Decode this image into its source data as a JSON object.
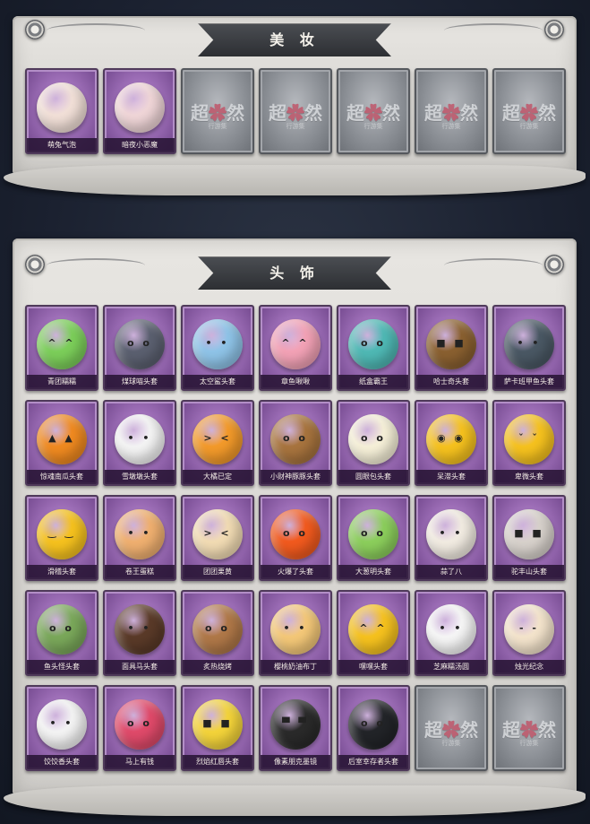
{
  "makeup": {
    "title": "美 妆",
    "items": [
      {
        "label": "萌兔气泡",
        "color": "#f2e0d8",
        "face": "",
        "filled": true
      },
      {
        "label": "暗夜小恶魔",
        "color": "#f0d6d8",
        "face": "",
        "filled": true
      },
      {
        "filled": false
      },
      {
        "filled": false
      },
      {
        "filled": false
      },
      {
        "filled": false
      },
      {
        "filled": false
      }
    ]
  },
  "headwear": {
    "title": "头 饰",
    "items": [
      {
        "label": "青团糯糯",
        "color": "#7ccf5a",
        "face": "^ ^",
        "filled": true
      },
      {
        "label": "煤球喵头套",
        "color": "#5b6070",
        "face": "o o",
        "filled": true
      },
      {
        "label": "太空鲨头套",
        "color": "#8fc4e8",
        "face": "• •",
        "filled": true
      },
      {
        "label": "章鱼啾啾",
        "color": "#f3a2b6",
        "face": "^ ^",
        "filled": true
      },
      {
        "label": "纸盒霸王",
        "color": "#4fb9b5",
        "face": "o o",
        "filled": true
      },
      {
        "label": "哈士奇头套",
        "color": "#8a6030",
        "face": "■ ■",
        "filled": true
      },
      {
        "label": "萨卡班甲鱼头套",
        "color": "#4a5864",
        "face": "• •",
        "filled": true
      },
      {
        "label": "惊魂南瓜头套",
        "color": "#f08a20",
        "face": "▲ ▲",
        "filled": true
      },
      {
        "label": "雪墩墩头套",
        "color": "#f4f4f4",
        "face": "• •",
        "filled": true
      },
      {
        "label": "大橘已定",
        "color": "#f39a2a",
        "face": "> <",
        "filled": true
      },
      {
        "label": "小财神豚豚头套",
        "color": "#a8743e",
        "face": "o o",
        "filled": true
      },
      {
        "label": "圆眼包头套",
        "color": "#f6f0d8",
        "face": "o o",
        "filled": true
      },
      {
        "label": "呆滞头套",
        "color": "#f6c21e",
        "face": "◉ ◉",
        "filled": true
      },
      {
        "label": "卑微头套",
        "color": "#f6c21e",
        "face": "ˇ ˇ",
        "filled": true
      },
      {
        "label": "滑稽头套",
        "color": "#f6c21e",
        "face": "‿ ‿",
        "filled": true
      },
      {
        "label": "卷王蛋糕",
        "color": "#f0b070",
        "face": "• •",
        "filled": true
      },
      {
        "label": "团团栗黄",
        "color": "#f2dcb4",
        "face": "> <",
        "filled": true
      },
      {
        "label": "火爆了头套",
        "color": "#f25a1e",
        "face": "o o",
        "filled": true
      },
      {
        "label": "大葱明头套",
        "color": "#8ccf5c",
        "face": "o o",
        "filled": true
      },
      {
        "label": "蒜了八",
        "color": "#f2ece2",
        "face": "• •",
        "filled": true
      },
      {
        "label": "驼丰山头套",
        "color": "#d8d2cc",
        "face": "■ ■",
        "filled": true
      },
      {
        "label": "鱼头怪头套",
        "color": "#7aa85a",
        "face": "o o",
        "filled": true
      },
      {
        "label": "面具马头套",
        "color": "#5a3a28",
        "face": "• •",
        "filled": true
      },
      {
        "label": "炙热烧烤",
        "color": "#b07848",
        "face": "o o",
        "filled": true
      },
      {
        "label": "樱桃奶油布丁",
        "color": "#f4c878",
        "face": "• •",
        "filled": true
      },
      {
        "label": "嘿嘿头套",
        "color": "#f6c21e",
        "face": "^ ^",
        "filled": true
      },
      {
        "label": "芝麻糯汤圆",
        "color": "#f6f6f6",
        "face": "• •",
        "filled": true
      },
      {
        "label": "烛光纪念",
        "color": "#f4e4cc",
        "face": "- -",
        "filled": true
      },
      {
        "label": "饺饺香头套",
        "color": "#f4f4f4",
        "face": "• •",
        "filled": true
      },
      {
        "label": "马上有钱",
        "color": "#e04a6a",
        "face": "o o",
        "filled": true
      },
      {
        "label": "烈焰红唇头套",
        "color": "#f4d43a",
        "face": "■ ■",
        "filled": true
      },
      {
        "label": "像素朋克墨镜",
        "color": "#2a2a2a",
        "face": "▀ ▀",
        "filled": true
      },
      {
        "label": "后室幸存者头套",
        "color": "#222428",
        "face": "o o",
        "filled": true
      },
      {
        "filled": false
      },
      {
        "filled": false
      }
    ]
  },
  "watermark": {
    "text_a": "超",
    "text_b": "然",
    "dot": "✿",
    "sub": "行游集"
  }
}
